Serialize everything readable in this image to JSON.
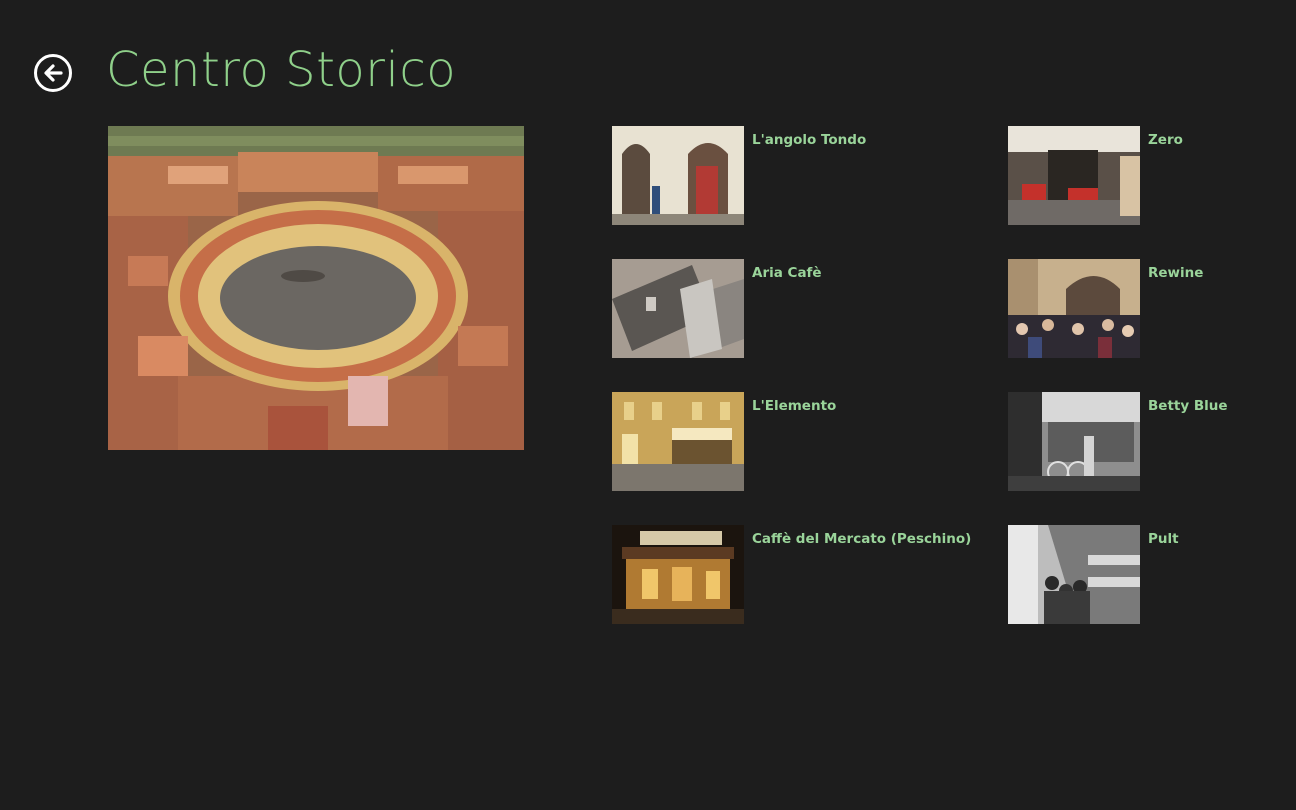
{
  "header": {
    "title": "Centro Storico",
    "back_icon": "back-arrow-icon"
  },
  "hero": {
    "subject": "aerial view of Piazza dell'Anfiteatro"
  },
  "items": [
    {
      "label": "L'angolo Tondo"
    },
    {
      "label": "Zero"
    },
    {
      "label": "Aria Cafè"
    },
    {
      "label": "Rewine"
    },
    {
      "label": "L'Elemento"
    },
    {
      "label": "Betty Blue"
    },
    {
      "label": "Caffè del Mercato (Peschino)"
    },
    {
      "label": "Pult"
    }
  ],
  "colors": {
    "background": "#1d1d1d",
    "accent": "#8fd08a",
    "label": "#9ad49a"
  }
}
